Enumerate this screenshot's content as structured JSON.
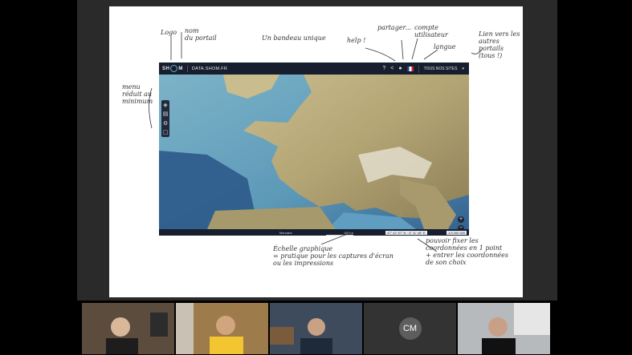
{
  "app": {
    "logo": "SH  M",
    "name": "DATA.SHOM.FR",
    "portals": "TOUS NOS SITES",
    "footer_projection": "Mercator",
    "footer_scale": "100km",
    "footer_coords": "47° 42' 57\" N · 3° 11' 48\" E",
    "footer_zoom": "1:5 000 000"
  },
  "annotations": {
    "logo": "Logo",
    "portal_name": "nom\ndu portail",
    "banner": "Un bandeau unique",
    "help": "help !",
    "share": "partager...",
    "account": "compte\nutilisateur",
    "language": "langue",
    "links": "Lien vers les\nautres\nportails\n(tous !)",
    "menu": "menu\nréduit au\nminimum",
    "scale": "Échelle graphique\n= pratique pour les captures d'écran\nou les impressions",
    "coords": "pouvoir fixer les\ncoordonnées en 1 point\n+ entrer les coordonnées\nde son choix"
  },
  "participants": [
    {
      "kind": "video",
      "tone": "#6b5a4a"
    },
    {
      "kind": "video",
      "tone": "#a8824e"
    },
    {
      "kind": "video",
      "tone": "#3f4d5f"
    },
    {
      "kind": "initials",
      "label": "CM"
    },
    {
      "kind": "video",
      "tone": "#b9bcc0"
    }
  ],
  "colors": {
    "header": "#171e2e",
    "sea": "#5b9dbd",
    "land": "#b5a77a"
  }
}
